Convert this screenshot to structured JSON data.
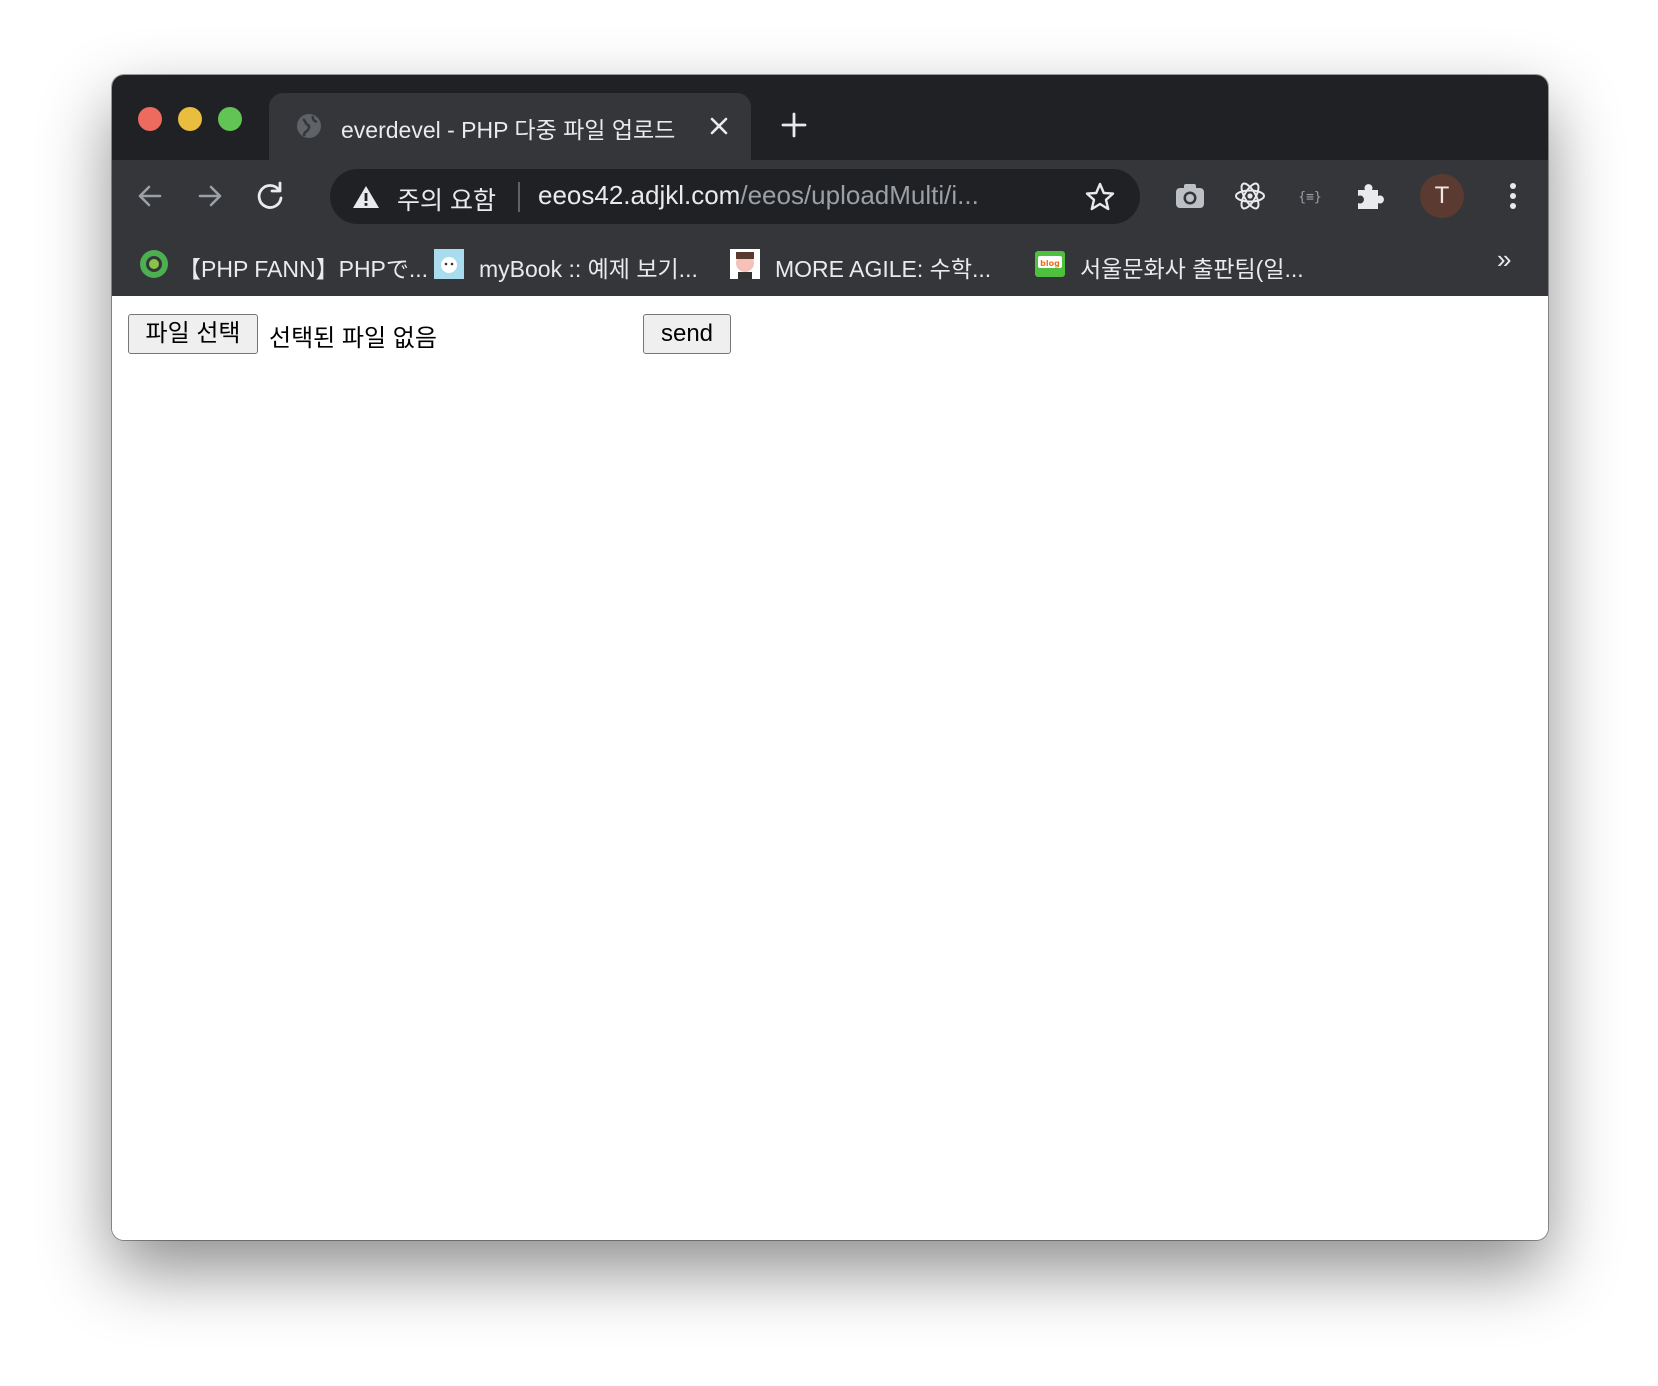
{
  "tab": {
    "title": "everdevel - PHP 다중 파일 업로드",
    "favicon": "globe-icon",
    "close_icon": "close-icon",
    "new_tab_icon": "plus-icon"
  },
  "toolbar": {
    "back_icon": "arrow-left-icon",
    "forward_icon": "arrow-right-icon",
    "reload_icon": "reload-icon",
    "security_icon": "warning-icon",
    "security_label": "주의 요함",
    "url_host": "eeos42.adjkl.com",
    "url_path": "/eeos/uploadMulti/i...",
    "bookmark_star_icon": "star-icon",
    "extensions": [
      "camera-icon",
      "react-atom-icon",
      "json-braces-icon",
      "puzzle-icon"
    ],
    "profile_initial": "T",
    "menu_icon": "kebab-menu-icon"
  },
  "bookmarks": {
    "items": [
      {
        "label": "【PHP FANN】PHPで...",
        "icon": "php-fann-icon"
      },
      {
        "label": "myBook :: 예제 보기...",
        "icon": "mybook-icon"
      },
      {
        "label": "MORE AGILE: 수학...",
        "icon": "more-agile-icon"
      },
      {
        "label": "서울문화사 출판팀(일...",
        "icon": "blog-icon"
      }
    ],
    "more_label": "»"
  },
  "page": {
    "file_button_label": "파일 선택",
    "file_status": "선택된 파일 없음",
    "send_button_label": "send"
  },
  "colors": {
    "tabstrip_bg": "#202124",
    "toolbar_bg": "#35363a",
    "traffic_red": "#ed6a5e",
    "traffic_yellow": "#e9bd3e",
    "traffic_green": "#61c454",
    "avatar_bg": "#5b3a31"
  }
}
